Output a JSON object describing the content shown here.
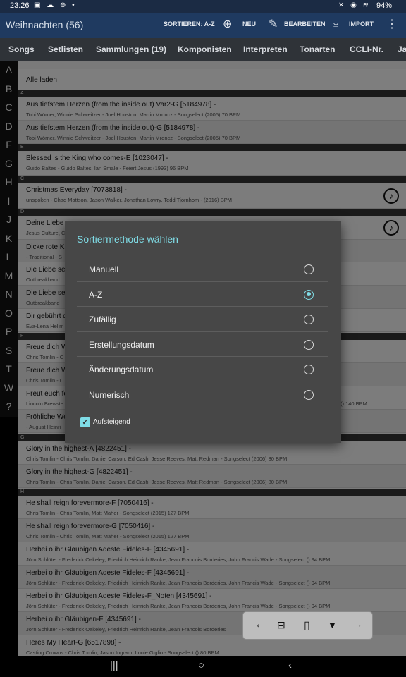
{
  "status": {
    "time": "23:26",
    "battery": "94%"
  },
  "appbar": {
    "title": "Weihnachten (56)",
    "sort": "SORTIEREN: A-Z",
    "new": "NEU",
    "edit": "BEARBEITEN",
    "import": "IMPORT"
  },
  "tabs": [
    "Songs",
    "Setlisten",
    "Sammlungen (19)",
    "Komponisten",
    "Interpreten",
    "Tonarten",
    "CCLI-Nr.",
    "Ja"
  ],
  "alphabet": [
    "A",
    "B",
    "C",
    "D",
    "F",
    "G",
    "H",
    "I",
    "J",
    "K",
    "L",
    "M",
    "N",
    "O",
    "P",
    "S",
    "T",
    "W",
    "?"
  ],
  "list": {
    "load_all": "Alle laden",
    "sections": {
      "A": "A",
      "B": "B",
      "C": "C",
      "D": "D",
      "F": "F",
      "G": "G",
      "H": "H"
    },
    "rows": [
      {
        "title": "Aus tiefstem Herzen (from the inside out) Var2-G  [5184978] -",
        "sub": "Tobi Wörner, Winnie Schweitzer - Joel Houston, Martin Mroncz  - Songselect (2005)  70 BPM"
      },
      {
        "title": "Aus tiefstem Herzen (from the inside out)-G  [5184978] -",
        "sub": "Tobi Wörner, Winnie Schweitzer - Joel Houston, Martin Mroncz  - Songselect (2005)  70 BPM"
      },
      {
        "title": "Blessed is the King who comes-E  [1023047] -",
        "sub": "Guido Baltes - Guido Baltes, Ian Smale  - Feiert Jesus (1993)  96 BPM"
      },
      {
        "title": "Christmas Everyday  [7073818] -",
        "sub": "unspoken - Chad Mattson, Jason Walker, Jonathan Lowry, Tedd Tjornhom  -  (2016)   BPM"
      },
      {
        "title": "Deine Liebe",
        "sub": "Jesus Culture, C"
      },
      {
        "title": "Dicke rote K",
        "sub": "- Traditional  - S"
      },
      {
        "title": "Die Liebe sel",
        "sub": "Outbreakband"
      },
      {
        "title": "Die Liebe sel",
        "sub": "Outbreakband"
      },
      {
        "title": "Dir gebührt d",
        "sub": "Eva-Lena Hellm"
      },
      {
        "title": "Freue dich W",
        "sub": "Chris Tomlin - C"
      },
      {
        "title": "Freue dich W",
        "sub": "Chris Tomlin - C"
      },
      {
        "title": "Freut euch fe",
        "sub": "Lincoln Brewste",
        "extra": "()  140 BPM"
      },
      {
        "title": "Fröhliche We",
        "sub": "- August Heinri"
      },
      {
        "title": "Glory in the highest-A  [4822451] -",
        "sub": "Chris Tomlin - Chris Tomlin, Daniel Carson, Ed Cash, Jesse Reeves, Matt Redman  - Songselect (2006)  80 BPM"
      },
      {
        "title": "Glory in the highest-G  [4822451] -",
        "sub": "Chris Tomlin - Chris Tomlin, Daniel Carson, Ed Cash, Jesse Reeves, Matt Redman  - Songselect (2006)  80 BPM"
      },
      {
        "title": "He shall reign forevermore-F  [7050416] -",
        "sub": "Chris Tomlin - Chris Tomlin, Matt Maher  - Songselect (2015)  127 BPM"
      },
      {
        "title": "He shall reign forevermore-G  [7050416] -",
        "sub": "Chris Tomlin - Chris Tomlin, Matt Maher  - Songselect (2015)  127 BPM"
      },
      {
        "title": "Herbei o ihr Gläubigen Adeste Fideles-F  [4345691] -",
        "sub": "Jörn Schlüter - Frederick Oakeley, Friedrich Heinrich Ranke, Jean Francois Borderies, John Francis Wade  - Songselect ()  94 BPM"
      },
      {
        "title": "Herbei o ihr Gläubigen Adeste Fideles-F  [4345691] -",
        "sub": "Jörn Schlüter - Frederick Oakeley, Friedrich Heinrich Ranke, Jean Francois Borderies, John Francis Wade  - Songselect ()  94 BPM"
      },
      {
        "title": "Herbei o ihr Gläubigen Adeste Fideles-F_Noten  [4345691] -",
        "sub": "Jörn Schlüter - Frederick Oakeley, Friedrich Heinrich Ranke, Jean Francois Borderies, John Francis Wade  - Songselect ()  94 BPM"
      },
      {
        "title": "Herbei o ihr Gläubigen-F  [4345691] -",
        "sub": "Jörn Schlüter - Frederick Oakeley, Friedrich Heinrich Ranke, Jean Francois Borderies"
      },
      {
        "title": "Heres My Heart-G  [6517898] -",
        "sub": "Casting Crowns - Chris Tomlin, Jason Ingram, Louie Giglio  - Songselect ()  80 BPM"
      }
    ]
  },
  "dialog": {
    "title": "Sortiermethode wählen",
    "options": [
      "Manuell",
      "A-Z",
      "Zufällig",
      "Erstellungsdatum",
      "Änderungsdatum",
      "Numerisch"
    ],
    "selected": "A-Z",
    "checkbox_label": "Aufsteigend",
    "ascending": true
  },
  "icons": {
    "music": "♪",
    "back": "←",
    "forward": "→",
    "filter": "▼"
  }
}
